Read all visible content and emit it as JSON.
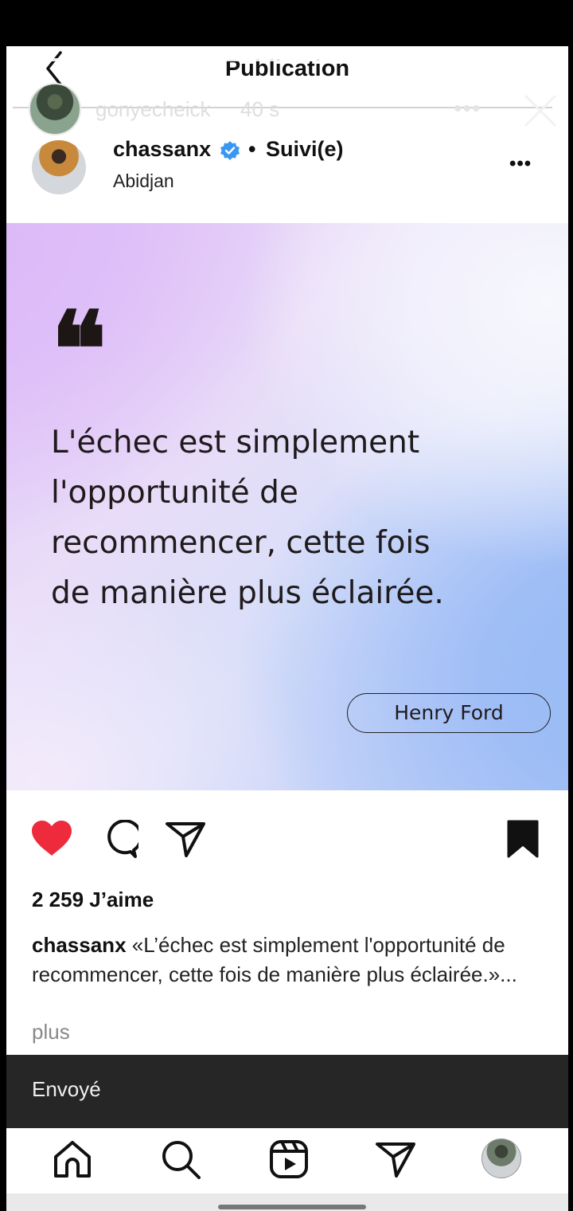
{
  "header": {
    "title": "Publication"
  },
  "story": {
    "username": "gonyecheick",
    "time": "40 s",
    "more": "•••"
  },
  "post": {
    "username": "chassanx",
    "separator": "•",
    "follow_status": "Suivi(e)",
    "location": "Abidjan",
    "more": "•••",
    "image": {
      "quote_mark": "❝",
      "quote_lines": [
        "L'échec est simplement",
        "l'opportunité de",
        "recommencer, cette fois",
        "de manière plus éclairée."
      ],
      "author": "Henry Ford"
    },
    "likes": "2 259 J’aime",
    "caption_user": "chassanx",
    "caption_text": "«L’échec est simplement l'opportunité de recommencer, cette fois de manière plus éclairée.»...",
    "more_label": "plus",
    "liked": true,
    "saved": true
  },
  "sent": {
    "label": "Envoyé"
  },
  "colors": {
    "like": "#ee2a3d",
    "verified": "#3897f0",
    "sent_bar": "#262626"
  },
  "nav": {
    "icons": [
      "home-icon",
      "search-icon",
      "reels-icon",
      "send-icon",
      "profile-avatar"
    ]
  }
}
